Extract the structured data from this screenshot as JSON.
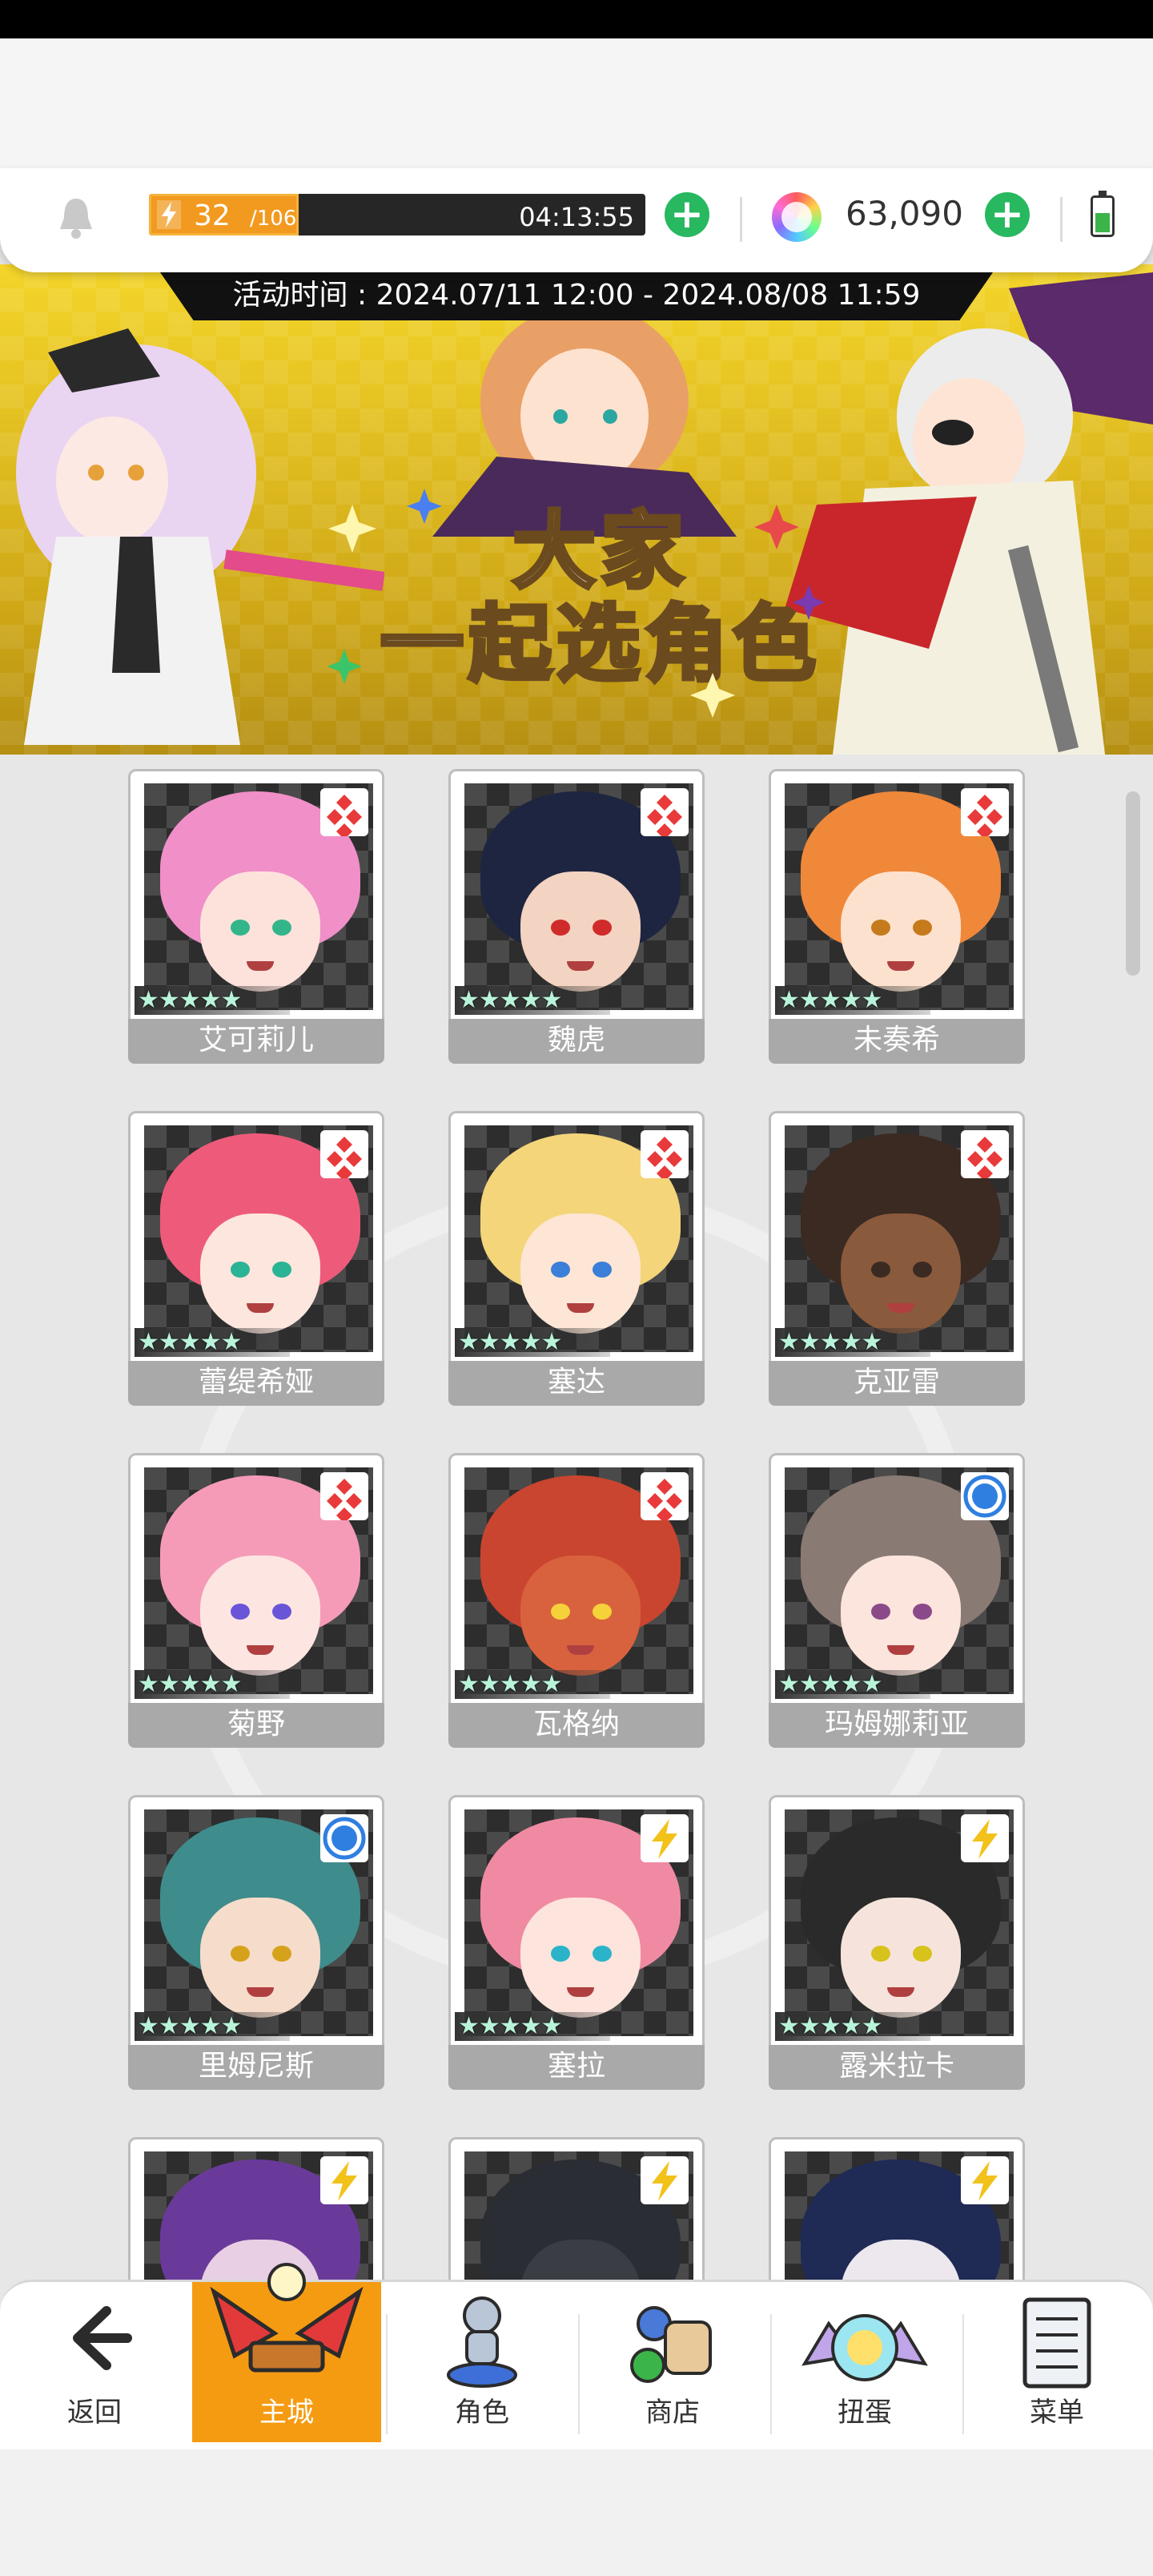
{
  "header": {
    "stamina_current": "32",
    "stamina_max": "/106",
    "stamina_fraction": 0.302,
    "timer": "04:13:55",
    "gem_count": "63,090"
  },
  "banner": {
    "event_time": "活动时间 : 2024.07/11 12:00 - 2024.08/08 11:59",
    "title_line1": "大家",
    "title_line2": "一起选角色"
  },
  "characters": [
    {
      "name": "艾可莉儿",
      "stars": "★★★★★",
      "type": "diamond",
      "hair": "#f08fc8",
      "skin": "#fde2dc",
      "eyes": "#33b58a"
    },
    {
      "name": "魏虎",
      "stars": "★★★★★",
      "type": "diamond",
      "hair": "#1e2540",
      "skin": "#f3d3c1",
      "eyes": "#d02b2b"
    },
    {
      "name": "未奏希",
      "stars": "★★★★★",
      "type": "diamond",
      "hair": "#f0883a",
      "skin": "#fde1cf",
      "eyes": "#c57a1c"
    },
    {
      "name": "蕾缇希娅",
      "stars": "★★★★★",
      "type": "diamond",
      "hair": "#ee5b7a",
      "skin": "#fde6de",
      "eyes": "#2bb395"
    },
    {
      "name": "塞达",
      "stars": "★★★★★",
      "type": "diamond",
      "hair": "#f4d57a",
      "skin": "#fde6d5",
      "eyes": "#3a7fd8"
    },
    {
      "name": "克亚雷",
      "stars": "★★★★★",
      "type": "diamond",
      "hair": "#3a2a22",
      "skin": "#8a5a3c",
      "eyes": "#3a2a22"
    },
    {
      "name": "菊野",
      "stars": "★★★★★",
      "type": "diamond",
      "hair": "#f59bb8",
      "skin": "#fde6e2",
      "eyes": "#6a55d8"
    },
    {
      "name": "瓦格纳",
      "stars": "★★★★★",
      "type": "diamond",
      "hair": "#c9452f",
      "skin": "#d9623e",
      "eyes": "#f5d23a"
    },
    {
      "name": "玛姆娜莉亚",
      "stars": "★★★★★",
      "type": "circle",
      "hair": "#8a7a74",
      "skin": "#fbe5dc",
      "eyes": "#8a4a8a"
    },
    {
      "name": "里姆尼斯",
      "stars": "★★★★★",
      "type": "circle",
      "hair": "#3f8c8c",
      "skin": "#f6dccb",
      "eyes": "#d6a21c"
    },
    {
      "name": "塞拉",
      "stars": "★★★★★",
      "type": "lightning",
      "hair": "#f08aa2",
      "skin": "#fde4dc",
      "eyes": "#2ab3c9"
    },
    {
      "name": "露米拉卡",
      "stars": "★★★★★",
      "type": "lightning",
      "hair": "#2a2a2a",
      "skin": "#f6e4dc",
      "eyes": "#d8c21c"
    },
    {
      "name": "",
      "stars": "",
      "type": "lightning",
      "hair": "#6a3a9a",
      "skin": "#e8cfe4",
      "eyes": "#8a3ac8"
    },
    {
      "name": "",
      "stars": "",
      "type": "lightning",
      "hair": "#2a2d33",
      "skin": "#3a3d44",
      "eyes": "#35d6e0"
    },
    {
      "name": "",
      "stars": "",
      "type": "lightning",
      "hair": "#1f2a55",
      "skin": "#ece8ee",
      "eyes": "#c83a8a"
    }
  ],
  "nav": [
    {
      "label": "返回",
      "icon": "back-arrow-icon"
    },
    {
      "label": "主城",
      "icon": "castle-icon"
    },
    {
      "label": "角色",
      "icon": "character-icon"
    },
    {
      "label": "商店",
      "icon": "shop-bag-icon"
    },
    {
      "label": "扭蛋",
      "icon": "gacha-orb-icon"
    },
    {
      "label": "菜单",
      "icon": "menu-list-icon"
    }
  ],
  "colors": {
    "accent": "#f59b12",
    "plus": "#27b860",
    "diamond_badge": "#e83a3a",
    "circle_badge": "#2f7fe0",
    "lightning_badge": "#f2c21a"
  }
}
